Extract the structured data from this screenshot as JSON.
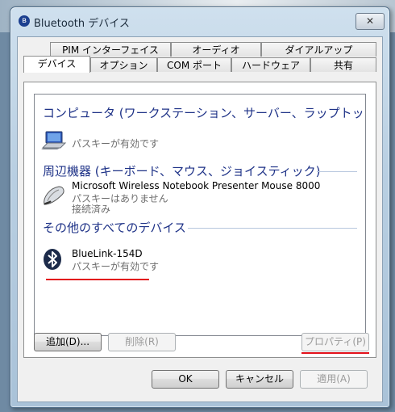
{
  "window": {
    "title": "Bluetooth デバイス",
    "close_label": "✕"
  },
  "tabs_back_row": [
    "PIM インターフェイス",
    "オーディオ",
    "ダイアルアップ"
  ],
  "tabs_front_row": [
    "デバイス",
    "オプション",
    "COM ポート",
    "ハードウェア",
    "共有"
  ],
  "active_tab": "デバイス",
  "groups": [
    {
      "header": "コンピュータ (ワークステーション、サーバー、ラップトップ...",
      "devices": [
        {
          "name": "",
          "status": "パスキーが有効です",
          "icon": "laptop-icon"
        }
      ]
    },
    {
      "header": "周辺機器 (キーボード、マウス、ジョイスティック)",
      "devices": [
        {
          "name": "Microsoft Wireless Notebook Presenter Mouse 8000",
          "status": "パスキーはありません",
          "status2": "接続済み",
          "icon": "mouse-icon"
        }
      ]
    },
    {
      "header": "その他のすべてのデバイス",
      "devices": [
        {
          "name": "BlueLink-154D",
          "status": "パスキーが有効です",
          "icon": "bluetooth-icon"
        }
      ]
    }
  ],
  "buttons": {
    "add": "追加(D)...",
    "remove": "削除(R)",
    "properties": "プロパティ(P)",
    "ok": "OK",
    "cancel": "キャンセル",
    "apply": "適用(A)"
  },
  "colors": {
    "group_header": "#1e3287",
    "highlight_underline": "#e3121b"
  }
}
